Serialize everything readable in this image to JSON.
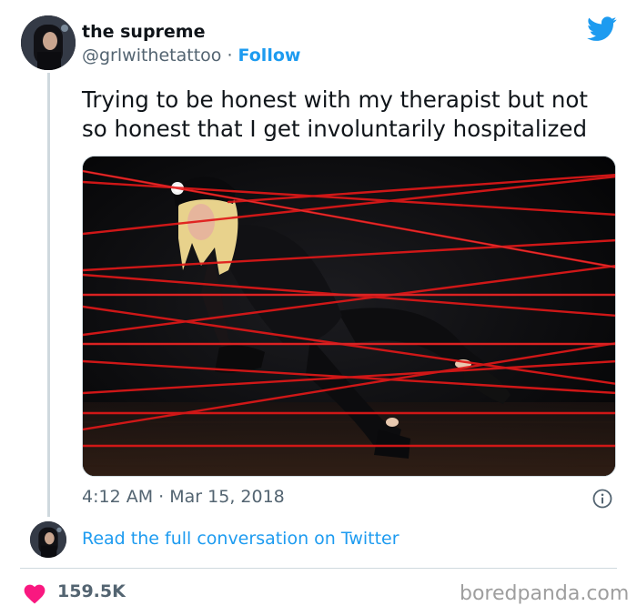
{
  "tweet": {
    "display_name": "the supreme",
    "handle": "@grlwithetattoo",
    "separator": "·",
    "follow_label": "Follow",
    "text": "Trying to be honest with my therapist but not so honest that I get involuntarily hospitalized",
    "time": "4:12 AM",
    "date": "Mar 15, 2018",
    "read_link": "Read the full conversation on Twitter",
    "likes": "159.5K"
  },
  "watermark": "boredpanda.com",
  "icons": {
    "logo": "twitter-bird-icon",
    "info": "info-icon",
    "like": "heart-icon"
  },
  "colors": {
    "accent": "#1d9bf0",
    "like": "#f91880",
    "secondary_text": "#536471",
    "laser": "#e01818"
  }
}
